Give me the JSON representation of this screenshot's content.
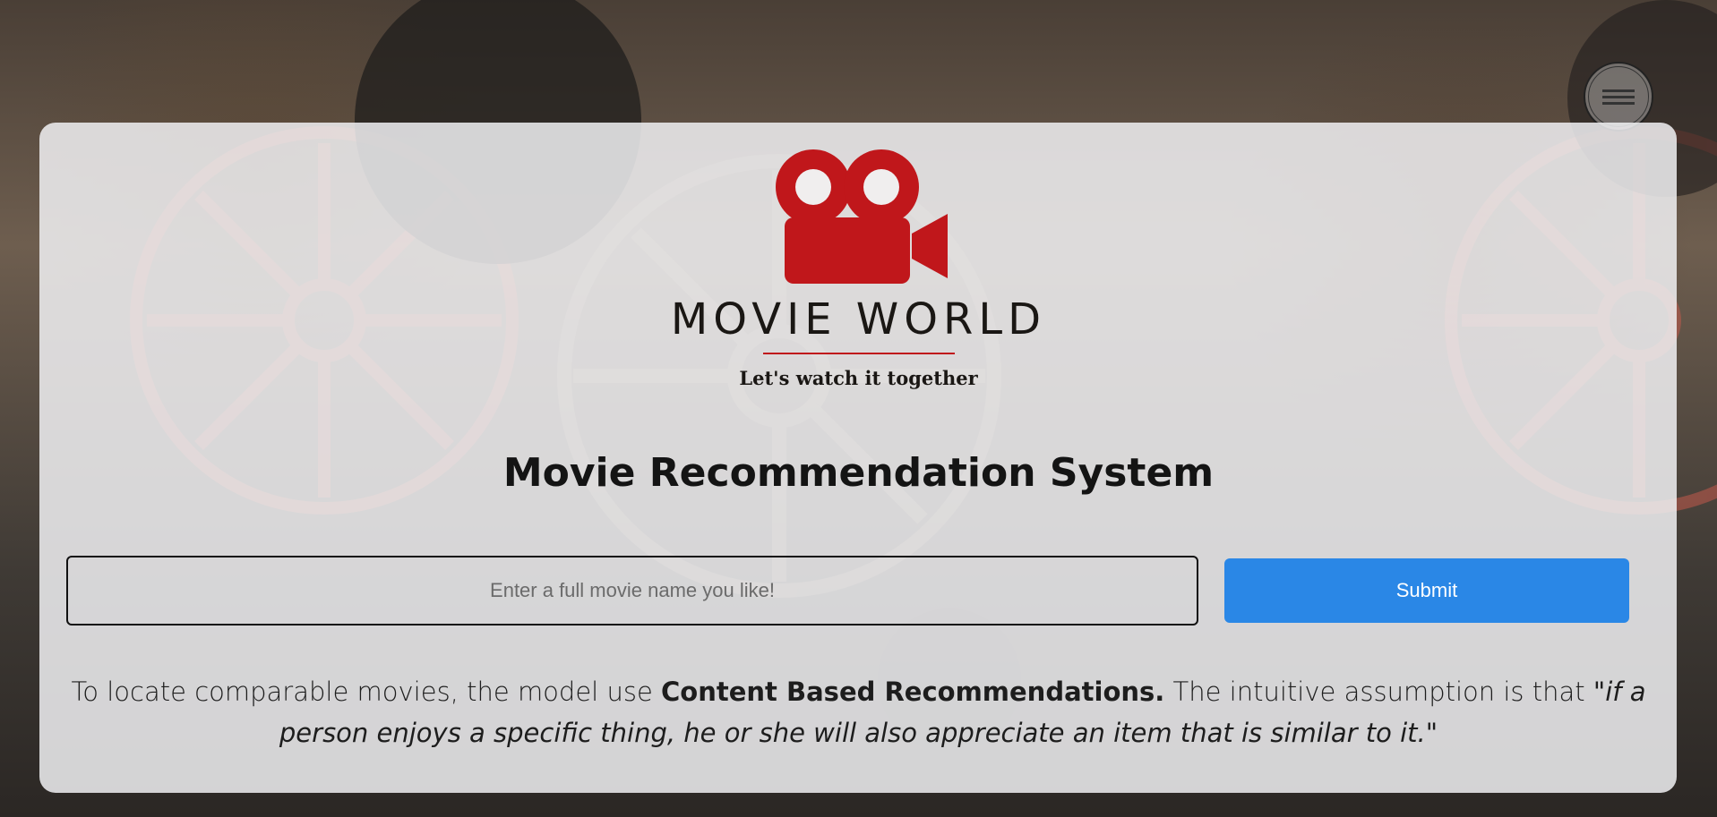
{
  "brand": {
    "name": "MOVIE WORLD",
    "tagline": "Let's watch it together",
    "accent_color": "#c0171b"
  },
  "main": {
    "title": "Movie Recommendation System",
    "search": {
      "placeholder": "Enter a full movie name you like!",
      "value": ""
    },
    "submit_label": "Submit",
    "submit_color": "#2a87e6",
    "description": {
      "part1": "To locate comparable movies, the model use ",
      "bold": "Content Based Recommendations.",
      "part2": " The intuitive assumption is that ",
      "quote": "\"if a person enjoys a specific thing, he or she will also appreciate an item that is similar to it.\""
    }
  },
  "icons": {
    "logo": "movie-camera-icon",
    "corner": "menu-icon"
  }
}
